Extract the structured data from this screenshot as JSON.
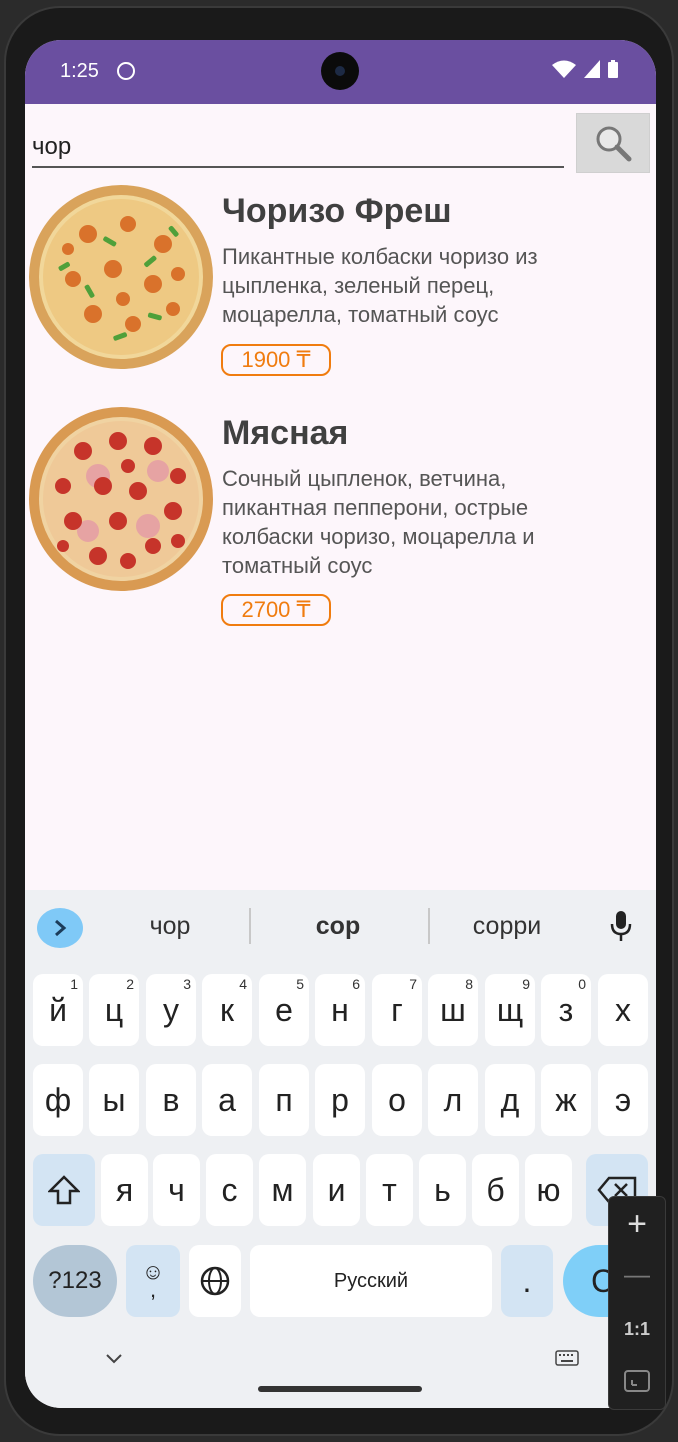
{
  "status": {
    "time": "1:25"
  },
  "search": {
    "value": "чор"
  },
  "items": [
    {
      "title": "Чоризо Фреш",
      "desc": "Пикантные колбаски чоризо из цыпленка, зеленый перец, моцарелла, томатный соус",
      "price": "1900 ₸"
    },
    {
      "title": "Мясная",
      "desc": "Сочный цыпленок, ветчина, пикантная пепперони, острые колбаски чоризо, моцарелла и томатный соус",
      "price": "2700 ₸"
    }
  ],
  "keyboard": {
    "suggestions": [
      "чор",
      "сор",
      "сорри"
    ],
    "row1": [
      {
        "k": "й",
        "n": "1"
      },
      {
        "k": "ц",
        "n": "2"
      },
      {
        "k": "у",
        "n": "3"
      },
      {
        "k": "к",
        "n": "4"
      },
      {
        "k": "е",
        "n": "5"
      },
      {
        "k": "н",
        "n": "6"
      },
      {
        "k": "г",
        "n": "7"
      },
      {
        "k": "ш",
        "n": "8"
      },
      {
        "k": "щ",
        "n": "9"
      },
      {
        "k": "з",
        "n": "0"
      },
      {
        "k": "х",
        "n": ""
      }
    ],
    "row2": [
      "ф",
      "ы",
      "в",
      "а",
      "п",
      "р",
      "о",
      "л",
      "д",
      "ж",
      "э"
    ],
    "row3": [
      "я",
      "ч",
      "с",
      "м",
      "и",
      "т",
      "ь",
      "б",
      "ю"
    ],
    "num_key": "?123",
    "emoji_key": "☺",
    "comma": ",",
    "space": "Русский",
    "period": ".",
    "enter_partial": "С"
  },
  "side_toolbar": {
    "zoom_in": "+",
    "zoom_out": "—",
    "ratio": "1:1"
  },
  "colors": {
    "status_bar": "#6a4fa0",
    "price": "#f07c0f",
    "screen_bg": "#fdf6fb"
  }
}
